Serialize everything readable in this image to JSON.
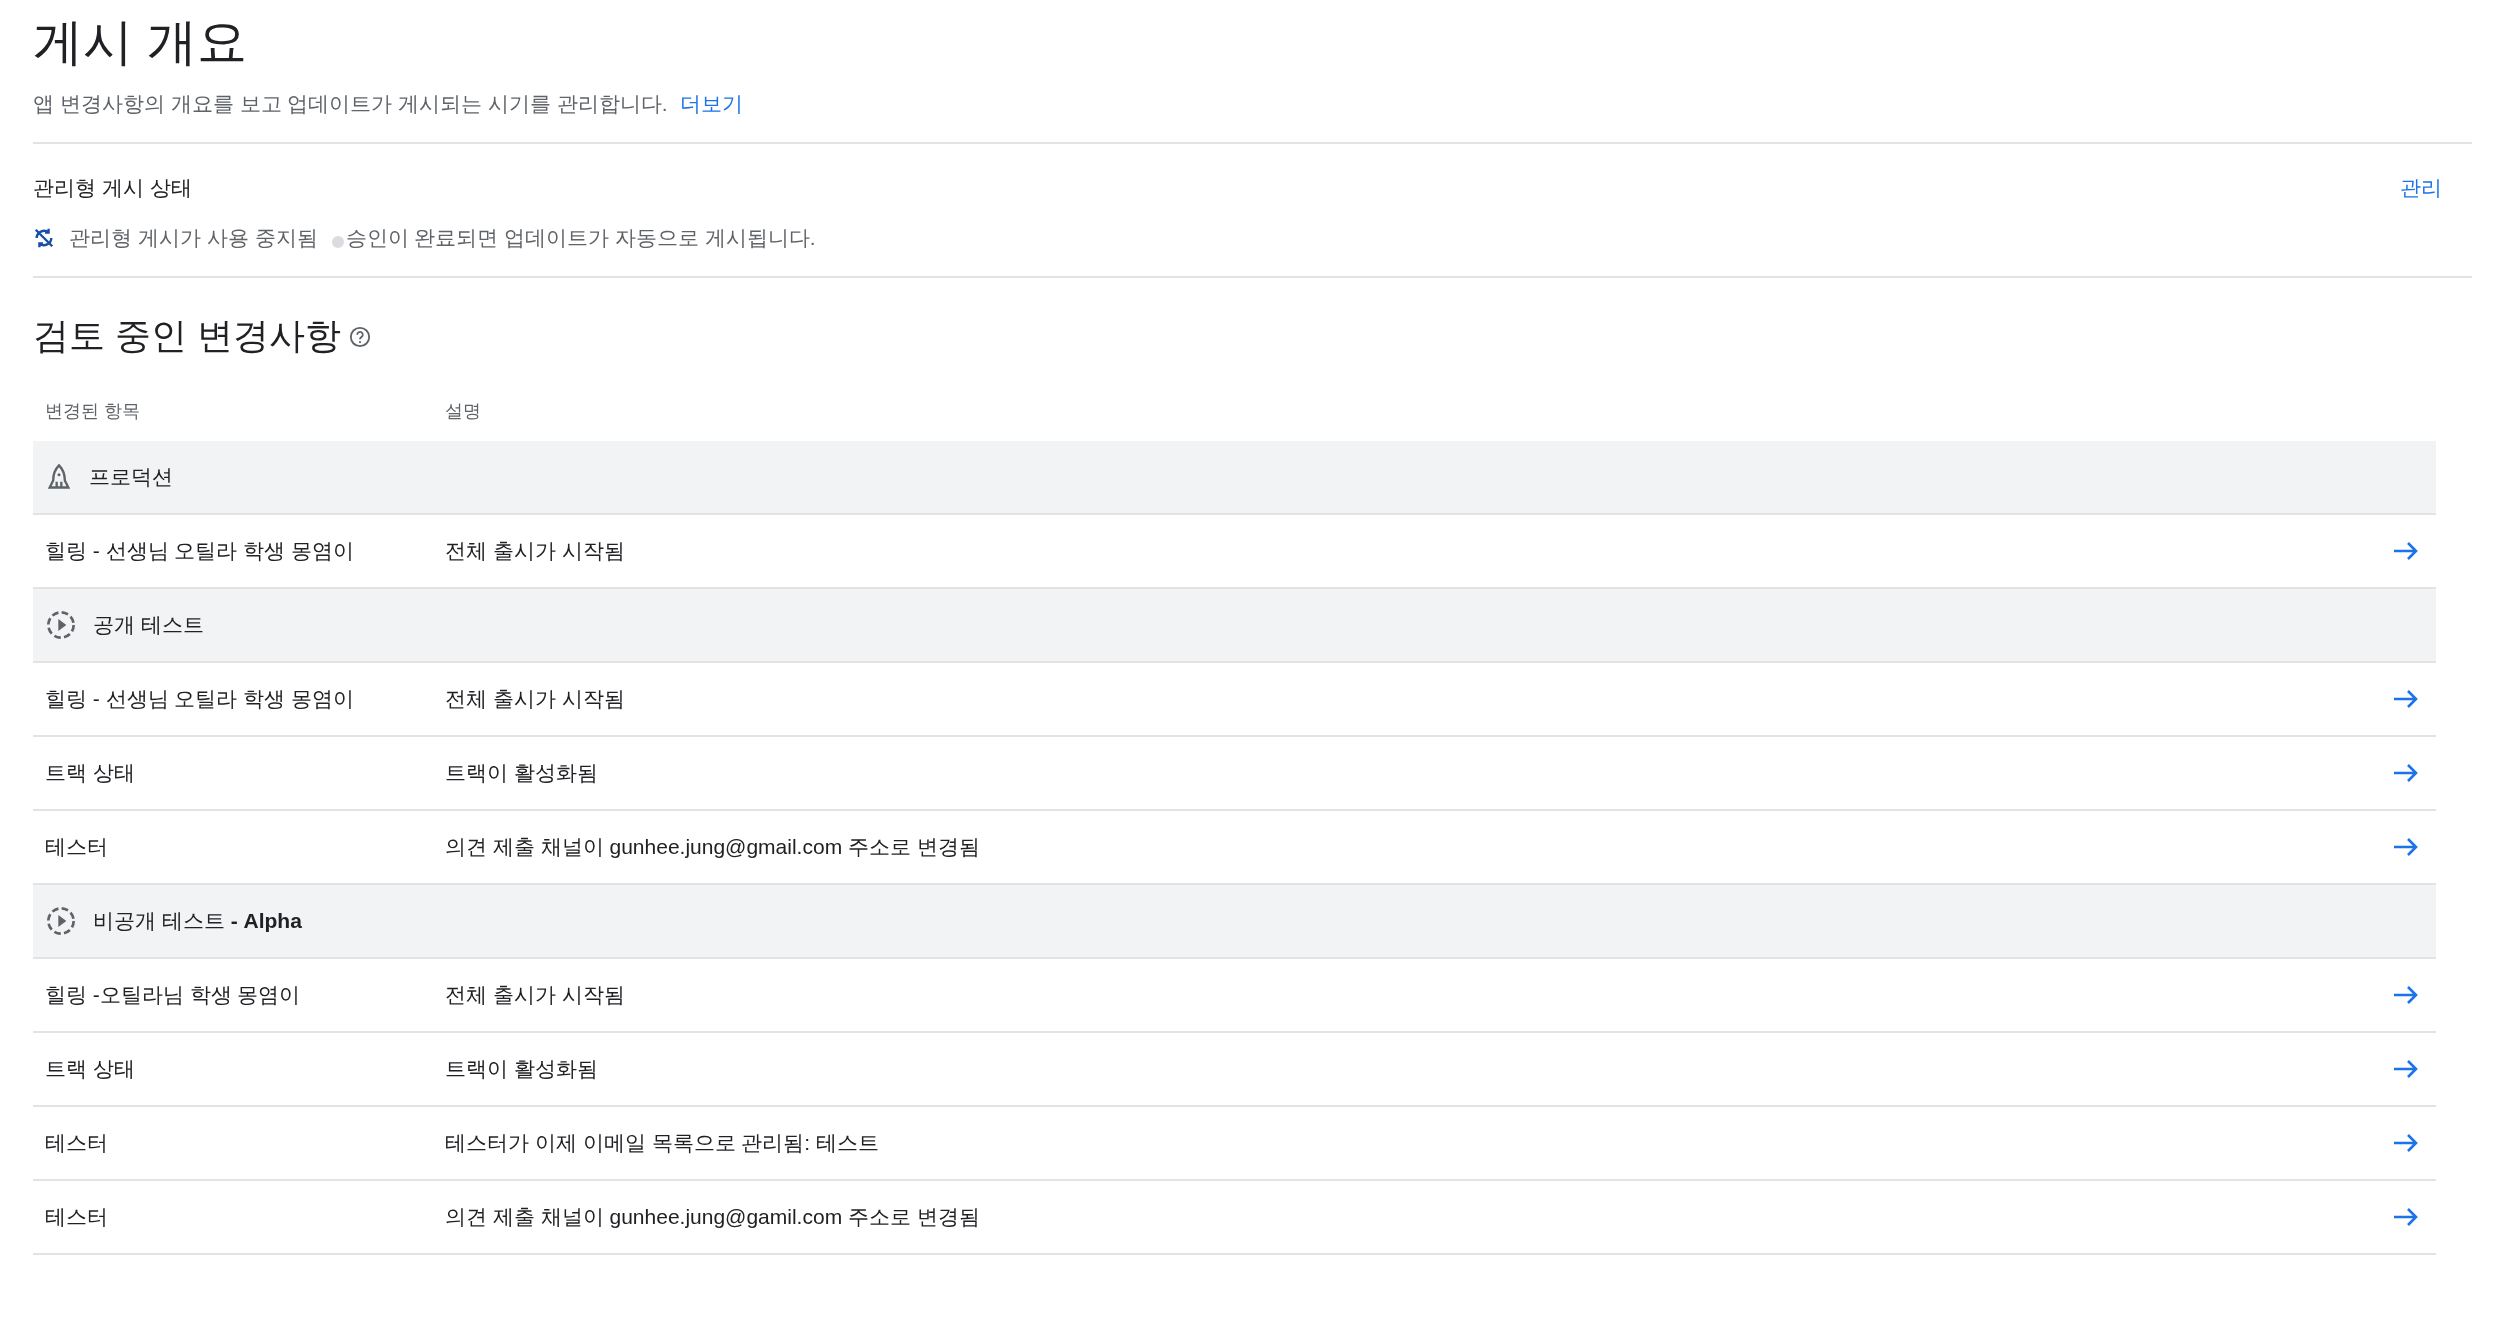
{
  "page": {
    "title": "게시 개요",
    "subtitle": "앱 변경사항의 개요를 보고 업데이트가 게시되는 시기를 관리합니다.",
    "learn_more": "더보기"
  },
  "managed_publishing": {
    "label": "관리형 게시 상태",
    "manage_link": "관리",
    "status": "관리형 게시가 사용 중지됨",
    "note": "승인이 완료되면 업데이트가 자동으로 게시됩니다."
  },
  "review": {
    "heading": "검토 중인 변경사항",
    "columns": [
      "변경된 항목",
      "설명"
    ],
    "groups": [
      {
        "kind": "production",
        "name": "프로덕션",
        "rows": [
          {
            "item": "힐링 - 선생님 오틸라 학생 몽염이",
            "description": "전체 출시가 시작됨"
          }
        ]
      },
      {
        "kind": "testing",
        "name": "공개 테스트",
        "rows": [
          {
            "item": "힐링 - 선생님 오틸라 학생 몽염이",
            "description": "전체 출시가 시작됨"
          },
          {
            "item": "트랙 상태",
            "description": "트랙이 활성화됨"
          },
          {
            "item": "테스터",
            "description": "의견 제출 채널이 gunhee.jung@gmail.com 주소로 변경됨"
          }
        ]
      },
      {
        "kind": "testing",
        "name": "비공개 테스트 **- Alpha**",
        "rows": [
          {
            "item": "힐링 -오틸라님 학생 몽염이",
            "description": "전체 출시가 시작됨"
          },
          {
            "item": "트랙 상태",
            "description": "트랙이 활성화됨"
          },
          {
            "item": "테스터",
            "description": "테스터가 이제 이메일 목록으로 관리됨: 테스트"
          },
          {
            "item": "테스터",
            "description": "의견 제출 채널이 gunhee.jung@gamil.com 주소로 변경됨"
          }
        ]
      }
    ]
  }
}
